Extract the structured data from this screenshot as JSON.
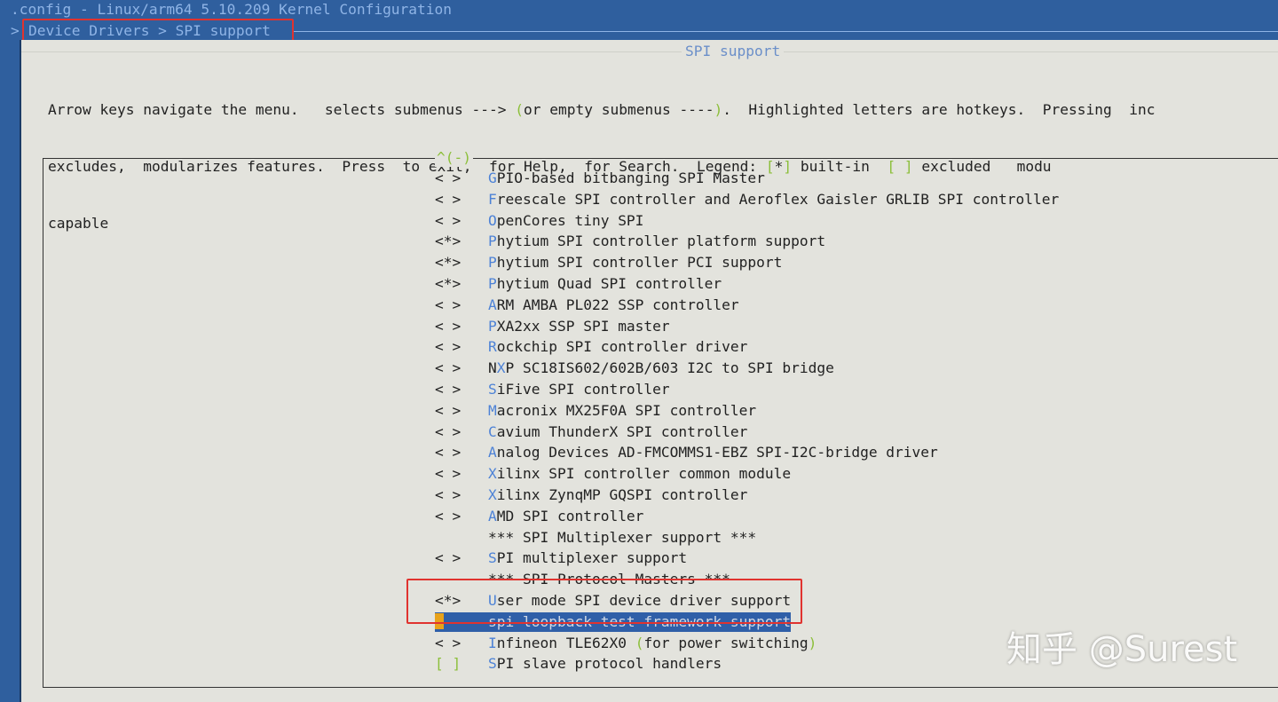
{
  "title_bar": ".config - Linux/arm64 5.10.209 Kernel Configuration",
  "breadcrumb": {
    "arrow": ">",
    "path": "Device Drivers > SPI support"
  },
  "window_title": "SPI support",
  "help_lines": [
    "Arrow keys navigate the menu.  <Enter> selects submenus ---> (or empty submenus ----).  Highlighted letters are hotkeys.  Pressing <Y> inc",
    "excludes, <M> modularizes features.  Press <Esc><Esc> to exit, <?> for Help, </> for Search.  Legend: [*] built-in  [ ] excluded  <M> modu",
    "capable"
  ],
  "scroll_indicator": "^(-)",
  "menu": [
    {
      "state": "< >",
      "hotkey": "G",
      "rest": "PIO-based bitbanging SPI Master"
    },
    {
      "state": "< >",
      "hotkey": "F",
      "rest": "reescale SPI controller and Aeroflex Gaisler GRLIB SPI controller"
    },
    {
      "state": "< >",
      "hotkey": "O",
      "rest": "penCores tiny SPI"
    },
    {
      "state": "<*>",
      "hotkey": "P",
      "rest": "hytium SPI controller platform support"
    },
    {
      "state": "<*>",
      "hotkey": "P",
      "rest": "hytium SPI controller PCI support"
    },
    {
      "state": "<*>",
      "hotkey": "P",
      "rest": "hytium Quad SPI controller"
    },
    {
      "state": "< >",
      "hotkey": "A",
      "rest": "RM AMBA PL022 SSP controller"
    },
    {
      "state": "< >",
      "hotkey": "P",
      "rest": "XA2xx SSP SPI master"
    },
    {
      "state": "< >",
      "hotkey": "R",
      "rest": "ockchip SPI controller driver"
    },
    {
      "state": "< >",
      "pre": "N",
      "hotkey": "X",
      "rest": "P SC18IS602/602B/603 I2C to SPI bridge"
    },
    {
      "state": "< >",
      "hotkey": "S",
      "rest": "iFive SPI controller"
    },
    {
      "state": "< >",
      "hotkey": "M",
      "rest": "acronix MX25F0A SPI controller"
    },
    {
      "state": "< >",
      "hotkey": "C",
      "rest": "avium ThunderX SPI controller"
    },
    {
      "state": "< >",
      "hotkey": "A",
      "rest": "nalog Devices AD-FMCOMMS1-EBZ SPI-I2C-bridge driver"
    },
    {
      "state": "< >",
      "hotkey": "X",
      "rest": "ilinx SPI controller common module"
    },
    {
      "state": "< >",
      "hotkey": "X",
      "rest": "ilinx ZynqMP GQSPI controller"
    },
    {
      "state": "< >",
      "hotkey": "A",
      "rest": "MD SPI controller"
    },
    {
      "state": "",
      "hotkey": "",
      "rest": "*** SPI Multiplexer support ***"
    },
    {
      "state": "< >",
      "hotkey": "S",
      "rest": "PI multiplexer support"
    },
    {
      "state": "",
      "hotkey": "",
      "rest": "*** SPI Protocol Masters ***"
    },
    {
      "state": "<*>",
      "hotkey": "U",
      "rest": "ser mode SPI device driver support"
    },
    {
      "state": "< >",
      "hotkey": "",
      "rest": "spi loopback test framework support",
      "selected": true
    },
    {
      "state": "< >",
      "hotkey": "I",
      "rest": "nfineon TLE62X0 ",
      "paren": "(",
      "rest2": "for power switching",
      "paren2": ")"
    },
    {
      "state": "[ ]",
      "hotkey": "S",
      "rest": "PI slave protocol handlers"
    }
  ],
  "watermark": "知乎 @Surest",
  "colors": {
    "terminal_blue": "#2f5f9e",
    "dialog_bg": "#e3e3dd",
    "hotkey": "#4d82d6",
    "green": "#8cbf3a",
    "selection": "#2f5fa8",
    "annotation": "#e0332f"
  }
}
